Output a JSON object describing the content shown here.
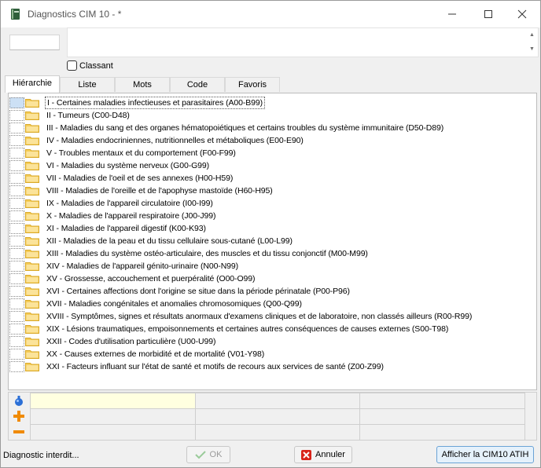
{
  "window": {
    "title": "Diagnostics CIM 10 - *"
  },
  "top": {
    "code_value": "",
    "description_value": "",
    "classant_label": "Classant",
    "classant_checked": false
  },
  "tabs": [
    {
      "label": "Hiérarchie",
      "active": true
    },
    {
      "label": "Liste",
      "active": false
    },
    {
      "label": "Mots",
      "active": false
    },
    {
      "label": "Code",
      "active": false
    },
    {
      "label": "Favoris",
      "active": false
    }
  ],
  "tree": {
    "selected_index": 0,
    "items": [
      "I - Certaines maladies infectieuses et parasitaires (A00-B99)",
      "II - Tumeurs (C00-D48)",
      "III - Maladies du sang et des organes hématopoiétiques et certains troubles du système immunitaire (D50-D89)",
      "IV - Maladies endocriniennes, nutritionnelles et métaboliques (E00-E90)",
      "V - Troubles mentaux et du comportement (F00-F99)",
      "VI - Maladies du système nerveux (G00-G99)",
      "VII - Maladies de l'oeil et de ses annexes (H00-H59)",
      "VIII - Maladies de l'oreille et de l'apophyse mastoïde (H60-H95)",
      "IX - Maladies de l'appareil circulatoire (I00-I99)",
      "X - Maladies de l'appareil respiratoire (J00-J99)",
      "XI - Maladies de l'appareil digestif (K00-K93)",
      "XII - Maladies de la peau et du tissu cellulaire sous-cutané (L00-L99)",
      "XIII - Maladies du système ostéo-articulaire, des muscles et du tissu conjonctif (M00-M99)",
      "XIV - Maladies de l'appareil génito-urinaire (N00-N99)",
      "XV - Grossesse, accouchement et puerpéralité (O00-O99)",
      "XVI - Certaines affections dont l'origine se situe dans la période périnatale (P00-P96)",
      "XVII - Maladies congénitales et anomalies chromosomiques (Q00-Q99)",
      "XVIII - Symptômes, signes et résultats anormaux d'examens cliniques et de laboratoire, non classés ailleurs (R00-R99)",
      "XIX - Lésions traumatiques, empoisonnements et certaines autres conséquences de causes externes (S00-T98)",
      "XXII - Codes d'utilisation particulière (U00-U99)",
      "XX - Causes externes de morbidité et de mortalité (V01-Y98)",
      "XXI - Facteurs influant sur l'état de santé et motifs de recours aux services de santé (Z00-Z99)"
    ]
  },
  "grid": {
    "rows": [
      [
        "",
        "",
        ""
      ],
      [
        "",
        "",
        ""
      ],
      [
        "",
        "",
        ""
      ]
    ]
  },
  "footer": {
    "status": "Diagnostic interdit...",
    "ok_label": "OK",
    "annuler_label": "Annuler",
    "afficher_label": "Afficher la CIM10 ATIH"
  },
  "colors": {
    "folder": "#f5cd5a",
    "folder_dark": "#d9a92a",
    "selection": "#cce0f5",
    "grid_highlight": "#ffffe0",
    "accent_button": "#e5f1fb"
  }
}
